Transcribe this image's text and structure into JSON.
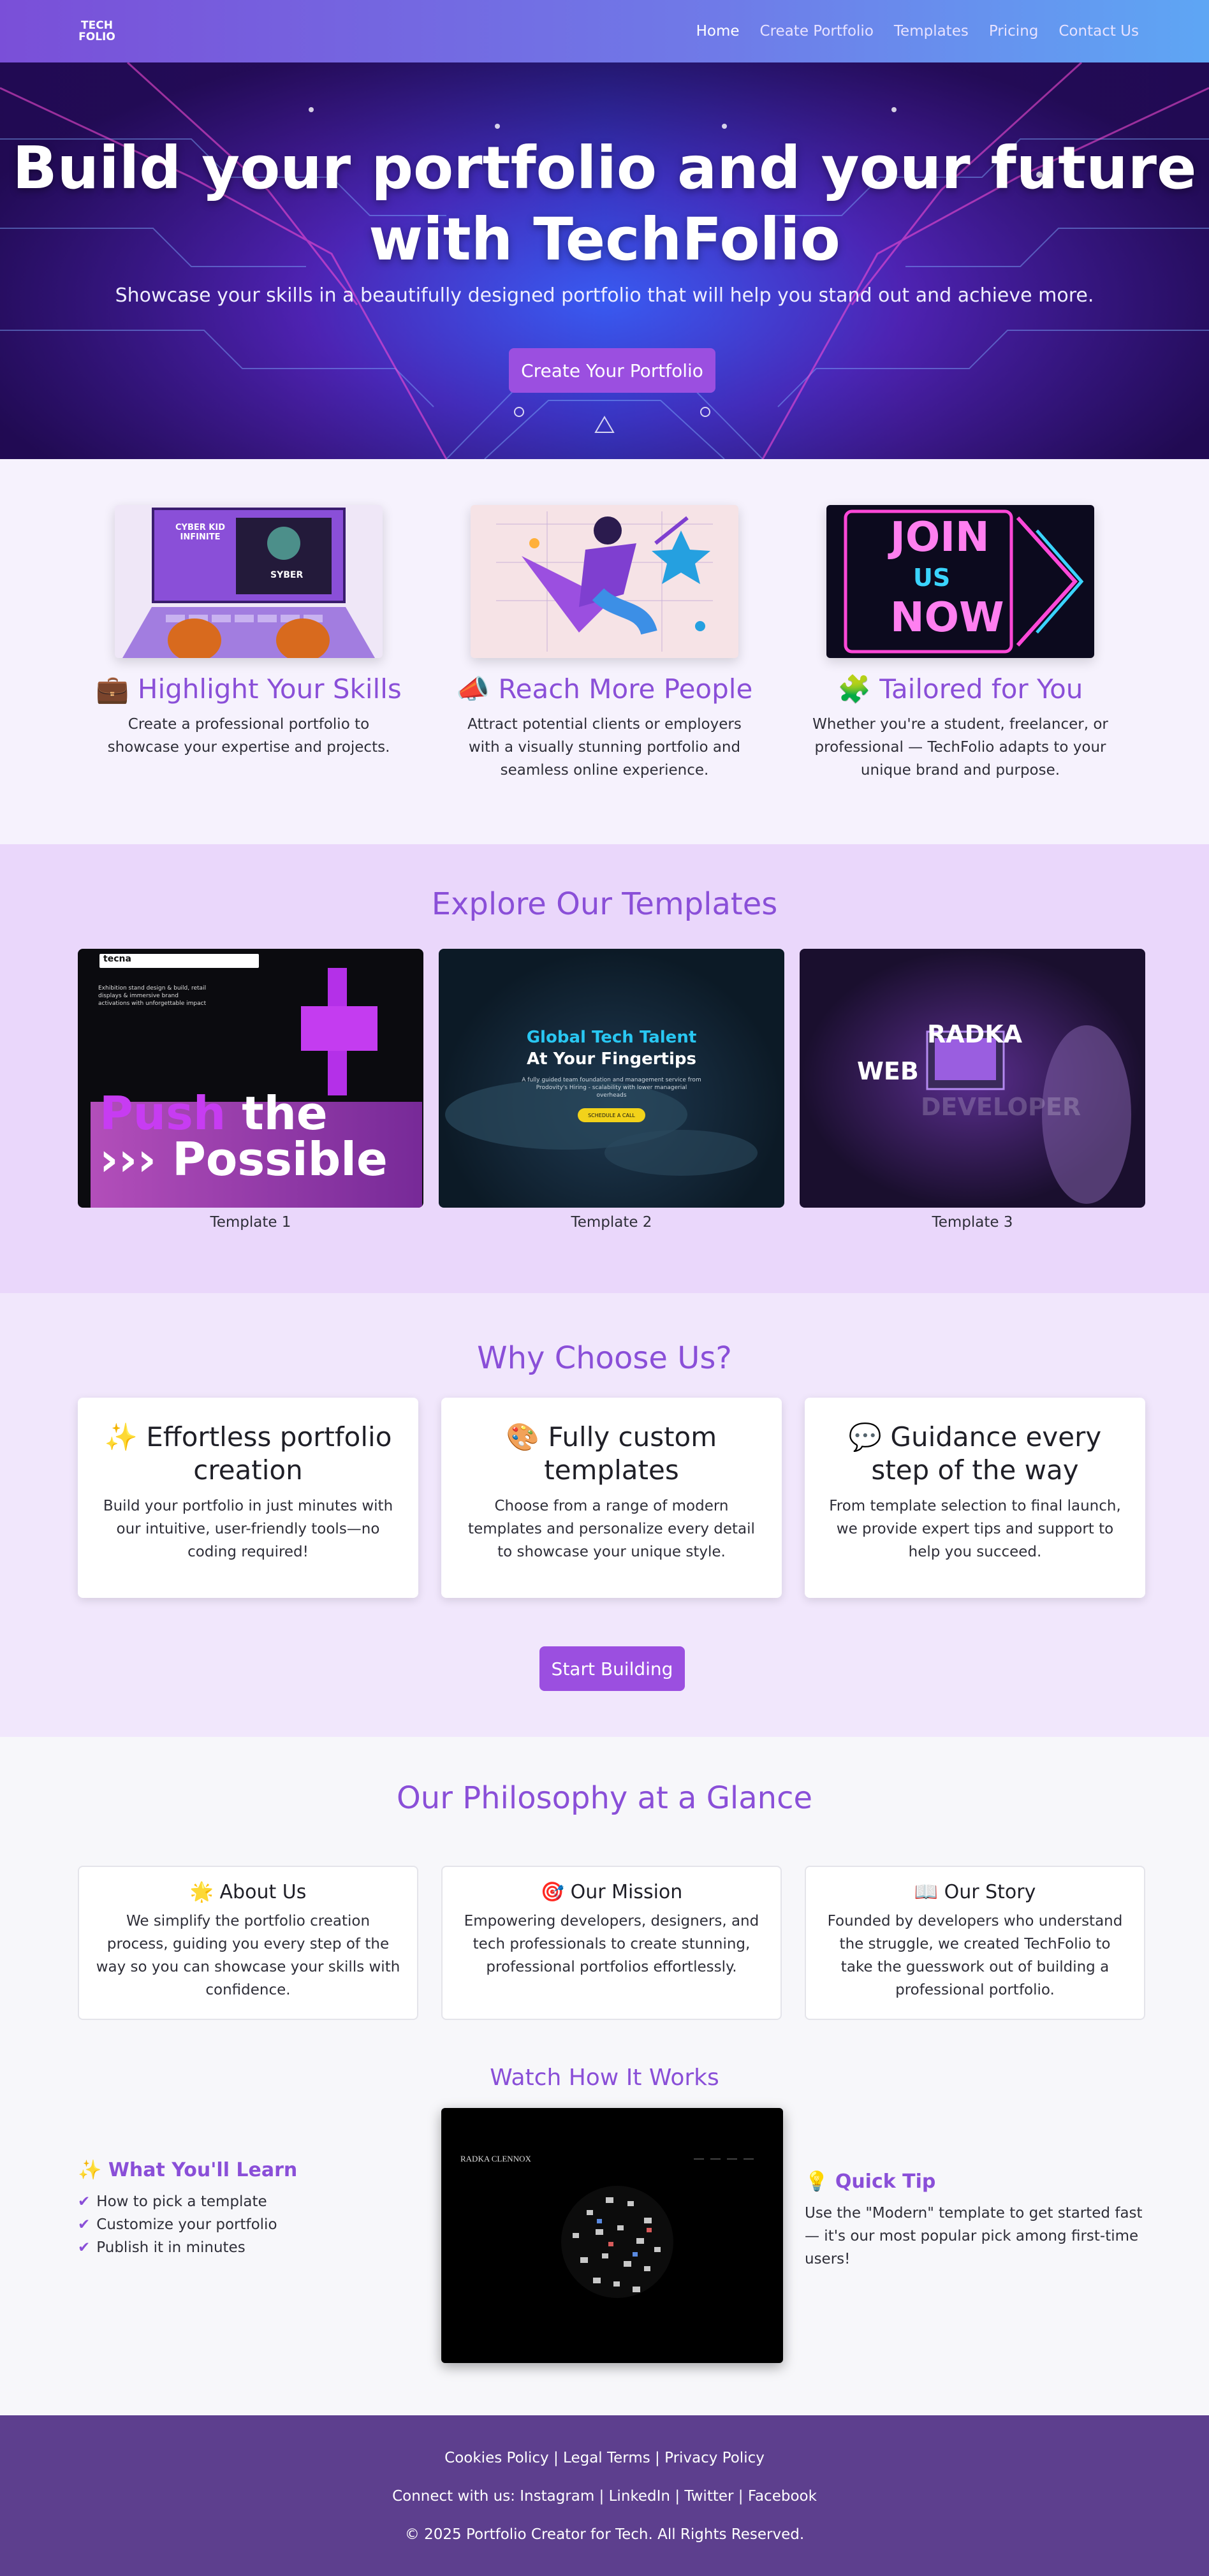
{
  "nav": {
    "logo_line1": "TECH",
    "logo_line2": "FOLIO",
    "links": [
      "Home",
      "Create Portfolio",
      "Templates",
      "Pricing",
      "Contact Us"
    ]
  },
  "hero": {
    "title": "Build your portfolio and your future with TechFolio",
    "subtitle": "Showcase your skills in a beautifully designed portfolio that will help you stand out and achieve more.",
    "cta": "Create Your Portfolio"
  },
  "features": [
    {
      "icon": "💼",
      "title": "Highlight Your Skills",
      "text": "Create a professional portfolio to showcase your expertise and projects.",
      "image_texts": [
        "CYBER KID INFINITE",
        "SYBER"
      ]
    },
    {
      "icon": "📣",
      "title": "Reach More People",
      "text": "Attract potential clients or employers with a visually stunning portfolio and seamless online experience."
    },
    {
      "icon": "🧩",
      "title": "Tailored for You",
      "text": "Whether you're a student, freelancer, or professional — TechFolio adapts to your unique brand and purpose.",
      "image_texts": [
        "JOIN",
        "US",
        "NOW"
      ]
    }
  ],
  "templates": {
    "title": "Explore Our Templates",
    "items": [
      {
        "caption": "Template 1",
        "brand": "tecna",
        "headline_a": "Push",
        "headline_b": "the",
        "headline_c": "Possible",
        "blurb": "Exhibition stand design & build, retail displays & immersive brand activations with unforgettable impact"
      },
      {
        "caption": "Template 2",
        "headline_a": "Global Tech Talent",
        "headline_b": "At Your Fingertips",
        "blurb": "A fully guided team foundation and management service from Prodovity's Hiring - scalability with lower managerial overheads",
        "cta": "SCHEDULE A CALL"
      },
      {
        "caption": "Template 3",
        "headline_a": "RADKA",
        "headline_b": "WEB",
        "headline_c": "DEVELOPER"
      }
    ]
  },
  "why": {
    "title": "Why Choose Us?",
    "cards": [
      {
        "icon": "✨",
        "title": "Effortless portfolio creation",
        "text": "Build your portfolio in just minutes with our intuitive, user-friendly tools—no coding required!"
      },
      {
        "icon": "🎨",
        "title": "Fully custom templates",
        "text": "Choose from a range of modern templates and personalize every detail to showcase your unique style."
      },
      {
        "icon": "💬",
        "title": "Guidance every step of the way",
        "text": "From template selection to final launch, we provide expert tips and support to help you succeed."
      }
    ],
    "cta": "Start Building"
  },
  "philosophy": {
    "title": "Our Philosophy at a Glance",
    "cards": [
      {
        "icon": "🌟",
        "title": "About Us",
        "text": "We simplify the portfolio creation process, guiding you every step of the way so you can showcase your skills with confidence."
      },
      {
        "icon": "🎯",
        "title": "Our Mission",
        "text": "Empowering developers, designers, and tech professionals to create stunning, professional portfolios effortlessly."
      },
      {
        "icon": "📖",
        "title": "Our Story",
        "text": "Founded by developers who understand the struggle, we created TechFolio to take the guesswork out of building a professional portfolio."
      }
    ],
    "watch_title": "Watch How It Works",
    "video_brand": "RADKA CLENNOX",
    "learn": {
      "icon": "✨",
      "title": "What You'll Learn",
      "items": [
        "How to pick a template",
        "Customize your portfolio",
        "Publish it in minutes"
      ]
    },
    "tip": {
      "icon": "💡",
      "title": "Quick Tip",
      "text": "Use the \"Modern\" template to get started fast — it's our most popular pick among first-time users!"
    }
  },
  "footer": {
    "links_line": "Cookies Policy | Legal Terms | Privacy Policy",
    "social_line": "Connect with us: Instagram | LinkedIn | Twitter | Facebook",
    "copyright": "© 2025 Portfolio Creator for Tech. All Rights Reserved."
  },
  "colors": {
    "accent": "#8a4fd8",
    "button": "#9b4fe0",
    "footer": "#5d3f8e",
    "templates_bg": "#ead7fb"
  }
}
